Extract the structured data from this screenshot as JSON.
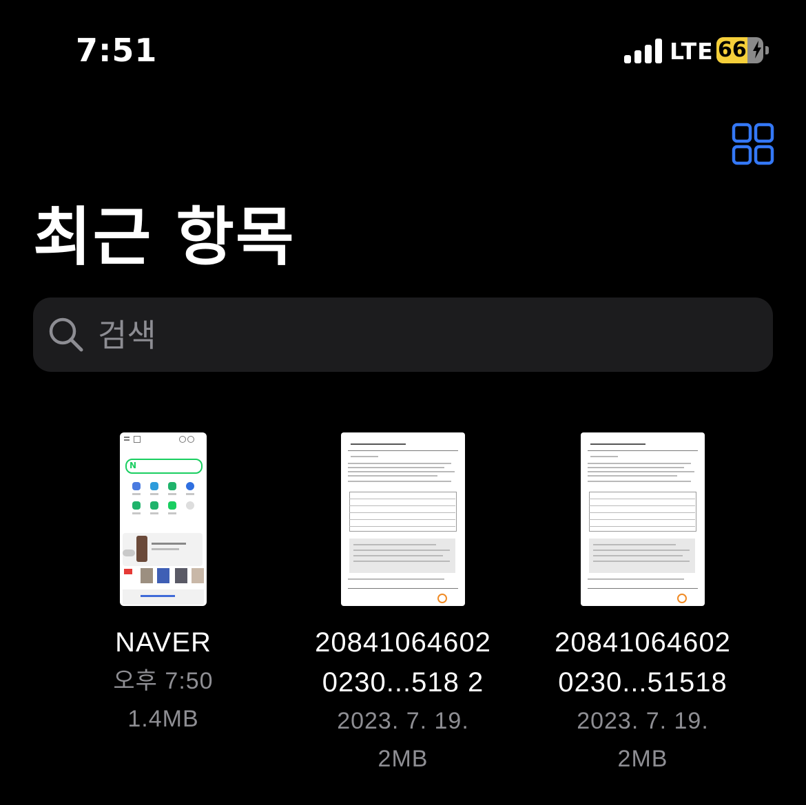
{
  "status_bar": {
    "time": "7:51",
    "network": "LTE",
    "battery_percent": "66",
    "battery_level": 0.66,
    "signal_bars": 4,
    "charging": true
  },
  "toolbar": {
    "grid_icon": "grid-view-icon",
    "accent_color": "#3478f6"
  },
  "page": {
    "title": "최근 항목"
  },
  "search": {
    "placeholder": "검색",
    "value": ""
  },
  "files": [
    {
      "name_line1": "NAVER",
      "name_line2": "",
      "meta1": "오후 7:50",
      "meta2": "1.4MB",
      "thumb_type": "screenshot"
    },
    {
      "name_line1": "20841064602",
      "name_line2": "0230...518 2",
      "meta1": "2023. 7. 19.",
      "meta2": "2MB",
      "thumb_type": "document"
    },
    {
      "name_line1": "20841064602",
      "name_line2": "0230...51518",
      "meta1": "2023. 7. 19.",
      "meta2": "2MB",
      "thumb_type": "document"
    }
  ],
  "colors": {
    "background": "#000000",
    "search_bg": "#1c1c1e",
    "secondary_text": "#8e8e93",
    "battery_yellow": "#f5cf3a"
  }
}
